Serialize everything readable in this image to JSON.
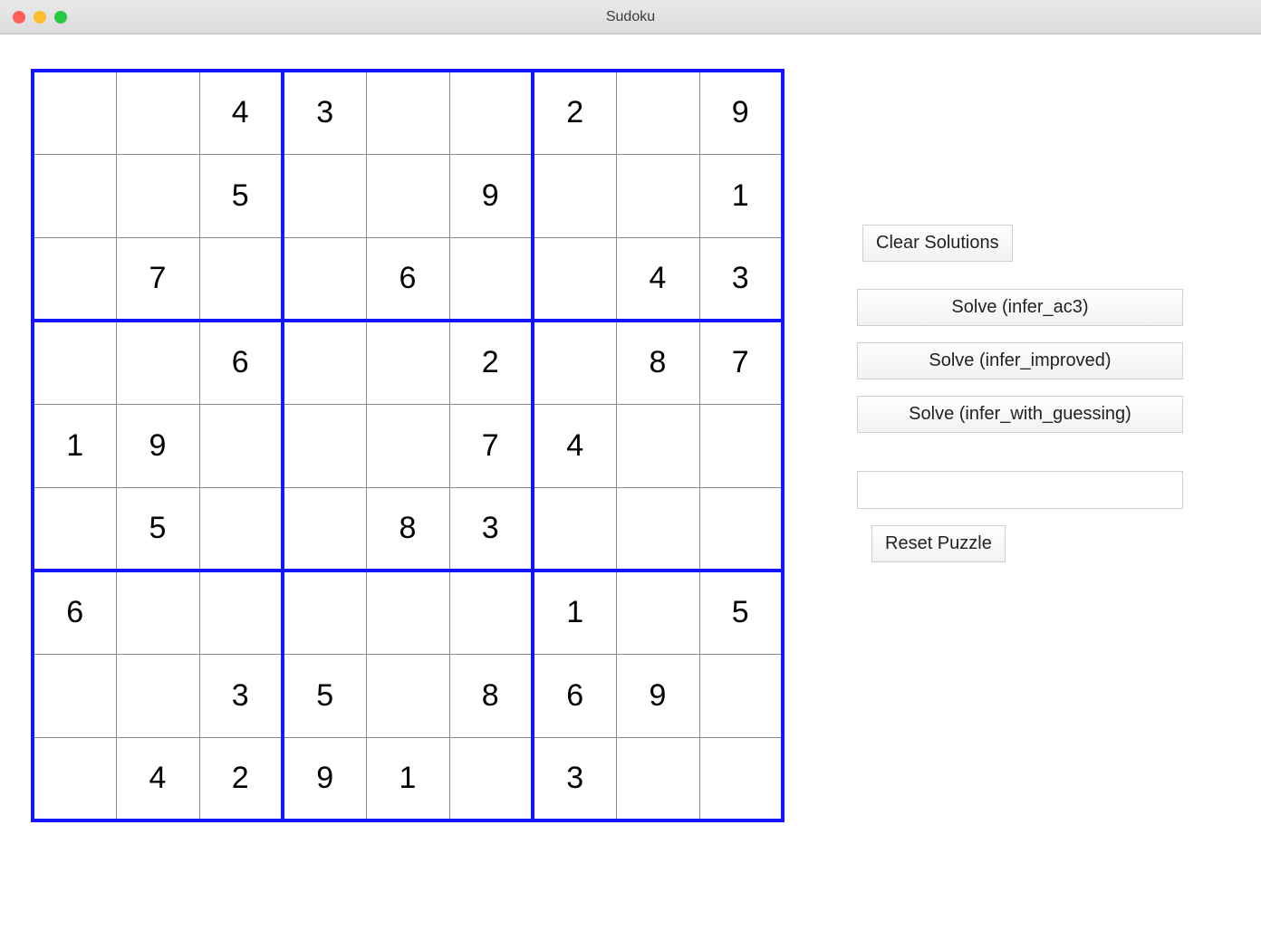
{
  "window": {
    "title": "Sudoku"
  },
  "grid": [
    [
      "",
      "",
      "4",
      "3",
      "",
      "",
      "2",
      "",
      "9"
    ],
    [
      "",
      "",
      "5",
      "",
      "",
      "9",
      "",
      "",
      "1"
    ],
    [
      "",
      "7",
      "",
      "",
      "6",
      "",
      "",
      "4",
      "3"
    ],
    [
      "",
      "",
      "6",
      "",
      "",
      "2",
      "",
      "8",
      "7"
    ],
    [
      "1",
      "9",
      "",
      "",
      "",
      "7",
      "4",
      "",
      ""
    ],
    [
      "",
      "5",
      "",
      "",
      "8",
      "3",
      "",
      "",
      ""
    ],
    [
      "6",
      "",
      "",
      "",
      "",
      "",
      "1",
      "",
      "5"
    ],
    [
      "",
      "",
      "3",
      "5",
      "",
      "8",
      "6",
      "9",
      ""
    ],
    [
      "",
      "4",
      "2",
      "9",
      "1",
      "",
      "3",
      "",
      ""
    ]
  ],
  "buttons": {
    "clear": "Clear Solutions",
    "solve_ac3": "Solve (infer_ac3)",
    "solve_improved": "Solve (infer_improved)",
    "solve_guessing": "Solve (infer_with_guessing)",
    "reset": "Reset Puzzle"
  },
  "input": {
    "value": ""
  }
}
